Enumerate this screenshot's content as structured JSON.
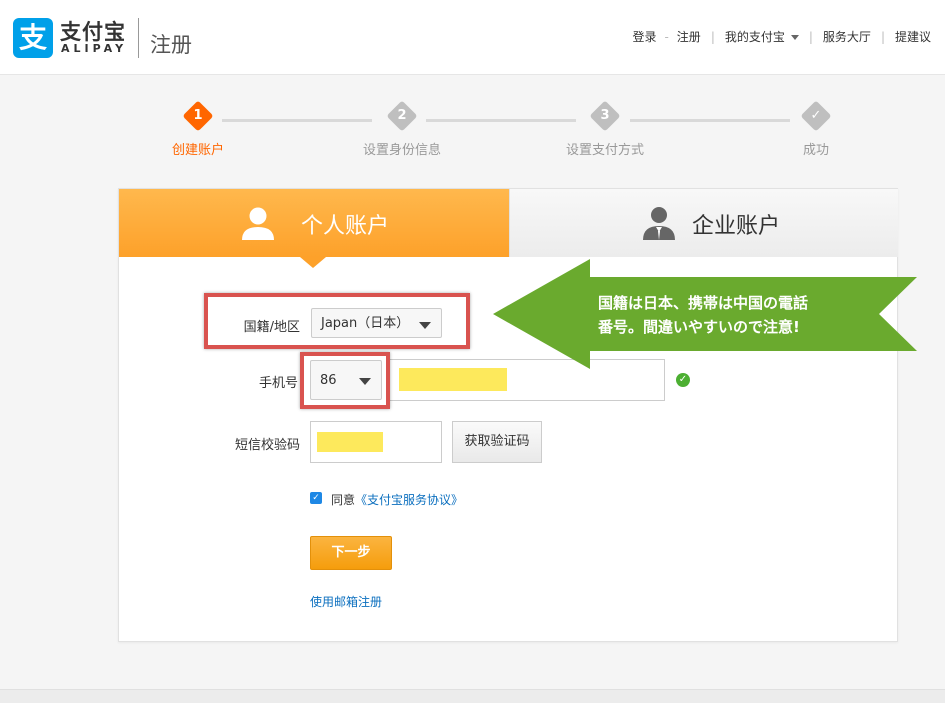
{
  "brand": {
    "logo_glyph": "支",
    "name_cn": "支付宝",
    "name_en": "ALIPAY",
    "page_title": "注册",
    "logo_color": "#00a0e9"
  },
  "top_nav": {
    "login": "登录",
    "separator": "-",
    "register": "注册",
    "my_alipay": "我的支付宝",
    "service_hall": "服务大厅",
    "feedback": "提建议"
  },
  "steps": [
    {
      "num": "1",
      "label": "创建账户",
      "active": true
    },
    {
      "num": "2",
      "label": "设置身份信息",
      "active": false
    },
    {
      "num": "3",
      "label": "设置支付方式",
      "active": false
    },
    {
      "num": "✓",
      "label": "成功",
      "active": false
    }
  ],
  "tabs": {
    "personal": "个人账户",
    "business": "企业账户",
    "active_color": "#fda12a"
  },
  "form": {
    "nationality_label": "国籍/地区",
    "nationality_value": "Japan（日本）",
    "phone_label": "手机号",
    "phone_code": "86",
    "sms_label": "短信校验码",
    "get_code_button": "获取验证码",
    "agree_prefix": "同意",
    "agree_link": "《支付宝服务协议》",
    "next_button": "下一步",
    "email_register_link": "使用邮箱注册"
  },
  "callout": {
    "line1": "国籍は日本、携帯は中国の電話",
    "line2": "番号。間違いやすいので注意!",
    "color": "#6aaa2e"
  },
  "colors": {
    "highlight": "#d9534f",
    "step_active": "#ff6600",
    "mask": "#fde95c"
  }
}
